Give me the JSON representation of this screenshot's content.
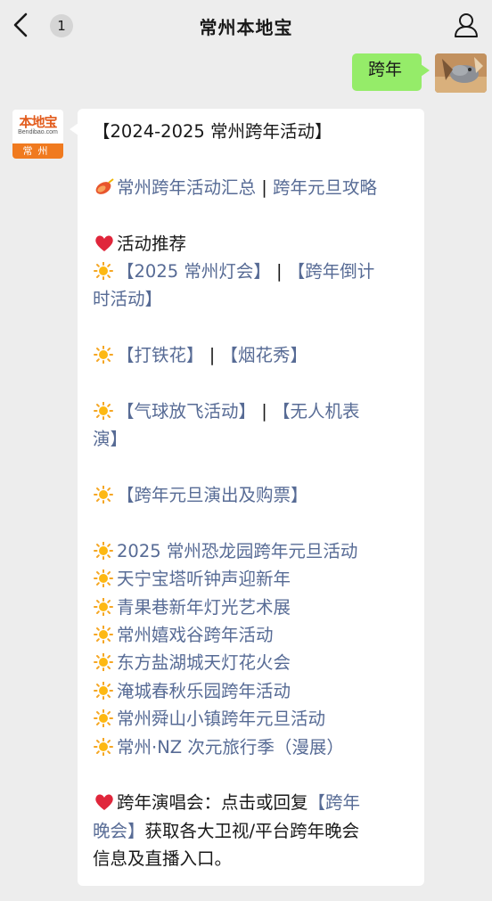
{
  "header": {
    "title": "常州本地宝",
    "unread_count": "1"
  },
  "outgoing": {
    "text": "跨年"
  },
  "account": {
    "logo_main": "本地宝",
    "logo_sub": "Bendibao.com",
    "logo_city": "常州"
  },
  "colors": {
    "background": "#ededed",
    "outgoing_bubble": "#95ec69",
    "link": "#576b95",
    "logo_orange": "#f07a1f"
  },
  "message": {
    "heading": "【2024-2025 常州跨年活动】",
    "summary_icon": "firecracker-icon",
    "summary_link_1": "常州跨年活动汇总",
    "summary_sep": " | ",
    "summary_link_2": "跨年元旦攻略",
    "recommend_icon": "heart-icon",
    "recommend_label": "活动推荐",
    "bullet_icon": "sun-icon",
    "rec1_link": "【2025 常州灯会】",
    "rec1_sep": " | ",
    "rec2_link_a": "【跨年倒计",
    "rec2_link_b": "时活动】",
    "rec3_link": "【打铁花】",
    "rec3_sep": " | ",
    "rec4_link": "【烟花秀】",
    "rec5_link": "【气球放飞活动】",
    "rec5_sep": " | ",
    "rec6_link_a": "【无人机表",
    "rec6_link_b": "演】",
    "rec7_link": "【跨年元旦演出及购票】",
    "events": [
      "2025 常州恐龙园跨年元旦活动",
      "天宁宝塔听钟声迎新年",
      "青果巷新年灯光艺术展",
      "常州嬉戏谷跨年活动",
      "东方盐湖城天灯花火会",
      "淹城春秋乐园跨年活动",
      "常州舜山小镇跨年元旦活动",
      "常州·NZ 次元旅行季（漫展）"
    ],
    "concert_prefix": "跨年演唱会：点击或回复",
    "concert_link_a": "【跨年",
    "concert_link_b": "晚会】",
    "concert_suffix_1": "获取各大卫视/平台跨年晚会",
    "concert_suffix_2": "信息及直播入口。"
  }
}
